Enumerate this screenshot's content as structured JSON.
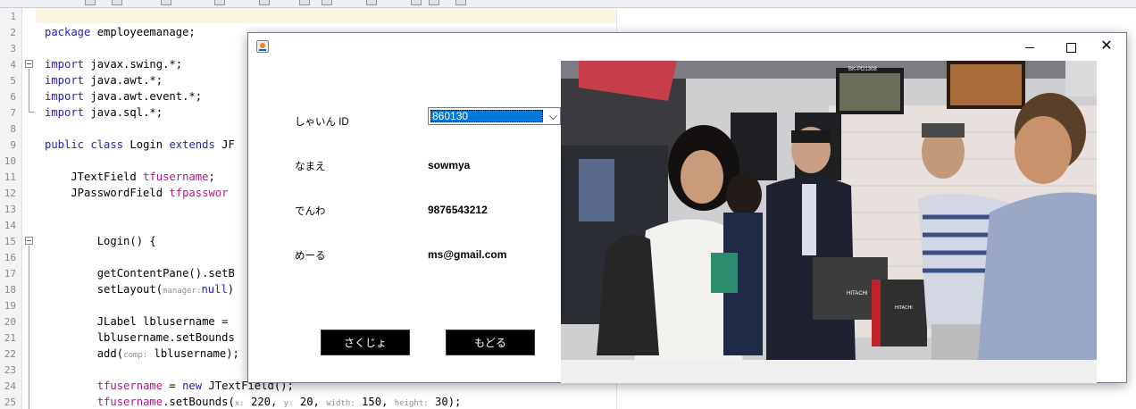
{
  "ide": {
    "lines": [
      {
        "n": "1",
        "html": ""
      },
      {
        "n": "2",
        "html": "<span class='kw'>package</span> employeemanage;"
      },
      {
        "n": "3",
        "html": ""
      },
      {
        "n": "4",
        "html": "<span class='kw'>import</span> javax.swing.*;"
      },
      {
        "n": "5",
        "html": "<span class='kw'>import</span> java.awt.*;"
      },
      {
        "n": "6",
        "html": "<span class='kw'>import</span> java.awt.event.*;"
      },
      {
        "n": "7",
        "html": "<span class='kw'>import</span> java.sql.*;"
      },
      {
        "n": "8",
        "html": ""
      },
      {
        "n": "9",
        "html": "<span class='kw'>public class</span> Login <span class='kw'>extends</span> JF"
      },
      {
        "n": "10",
        "html": ""
      },
      {
        "n": "11",
        "html": "    JTextField <span class='id'>tfusername</span>;"
      },
      {
        "n": "12",
        "html": "    JPasswordField <span class='id'>tfpasswor</span>"
      },
      {
        "n": "13",
        "html": ""
      },
      {
        "n": "14",
        "html": ""
      },
      {
        "n": "15",
        "html": "        Login() {"
      },
      {
        "n": "16",
        "html": ""
      },
      {
        "n": "17",
        "html": "        getContentPane().setB"
      },
      {
        "n": "18",
        "html": "        setLayout(<span class='hint'>manager:</span><span class='kw'>null</span>)"
      },
      {
        "n": "19",
        "html": ""
      },
      {
        "n": "20",
        "html": "        JLabel lblusername ="
      },
      {
        "n": "21",
        "html": "        lblusername.setBounds"
      },
      {
        "n": "22",
        "html": "        add(<span class='hint'>comp:</span> lblusername);"
      },
      {
        "n": "23",
        "html": ""
      },
      {
        "n": "24",
        "html": "        <span class='id'>tfusername</span> = <span class='kw'>new</span> JTextField();"
      },
      {
        "n": "25",
        "html": "        <span class='id'>tfusername</span>.setBounds(<span class='hint'>x:</span> 220, <span class='hint'>y:</span> 20, <span class='hint'>width:</span> 150, <span class='hint'>height:</span> 30);"
      }
    ]
  },
  "window": {
    "minimize_label": "",
    "maximize_label": "",
    "close_label": "✕"
  },
  "form": {
    "id_label": "しゃいん ID",
    "id_value": "860130",
    "name_label": "なまえ",
    "name_value": "sowmya",
    "phone_label": "でんわ",
    "phone_value": "9876543212",
    "email_label": "めーる",
    "email_value": "ms@gmail.com",
    "delete_button": "さくじょ",
    "back_button": "もどる"
  },
  "photo": {
    "sign_1": "BK-PD1308",
    "sign_2": "HITACHI",
    "sign_3": "HITACHI"
  }
}
